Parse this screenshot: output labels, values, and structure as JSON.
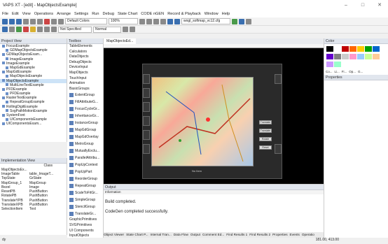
{
  "window": {
    "title": "VAPS XT - [edit] - MapObjectsExample]",
    "controls": [
      "–",
      "□",
      "✕"
    ]
  },
  "menu": [
    "File",
    "Edit",
    "View",
    "Operations",
    "Arrange",
    "Settings",
    "Run",
    "Debug",
    "State Chart",
    "CODE nGEN",
    "Record & Playback",
    "Window",
    "Help"
  ],
  "toolbar1": {
    "color_combo": "Default Colors",
    "zoom_combo": "100%",
    "file_combo": "wogl_softmap_vc12.cfg"
  },
  "toolbar2": {
    "line_combo": "Not Specified",
    "style_combo": "Normal"
  },
  "project_view": {
    "title": "Project View",
    "items": [
      {
        "label": "FocusExample",
        "sel": false
      },
      {
        "label": "GDMapObjectsExample",
        "sel": false
      },
      {
        "label": "GDMapObjectsExam...",
        "sel": false
      },
      {
        "label": "ImageExample",
        "sel": false
      },
      {
        "label": "ImageExample",
        "sel": false
      },
      {
        "label": "MapGdExample",
        "sel": false
      },
      {
        "label": "MapGdExample",
        "sel": false
      },
      {
        "label": "MapObjectsExample",
        "sel": false
      },
      {
        "label": "MapObjectsExample",
        "sel": true
      },
      {
        "label": "MultiLineTextExample",
        "sel": false
      },
      {
        "label": "PFDExample",
        "sel": false
      },
      {
        "label": "PFDExample",
        "sel": false
      },
      {
        "label": "RasterTextExample",
        "sel": false
      },
      {
        "label": "RepeatGroupExample",
        "sel": false
      },
      {
        "label": "RollingDigitExample",
        "sel": false
      },
      {
        "label": "SvgPathMotionExample",
        "sel": false
      },
      {
        "label": "SystemFont",
        "sel": false
      },
      {
        "label": "UIComponentsExample",
        "sel": false
      },
      {
        "label": "UIComponentsExam...",
        "sel": false
      }
    ]
  },
  "impl_view": {
    "title": "Implementation View",
    "class_header": "Class",
    "root": "MapObjectsEx...",
    "rows": [
      [
        "ImageTable",
        "table_ImageT..."
      ],
      [
        "TopState",
        "GrState"
      ],
      [
        "MapGroup_1",
        "MapGroup"
      ],
      [
        "Bezel",
        "Image"
      ],
      [
        "ResetPB",
        "PushButton"
      ],
      [
        "RotatePB",
        "PushButton"
      ],
      [
        "TranslateYPB",
        "PushButton"
      ],
      [
        "TranslateXPB",
        "PushButton"
      ],
      [
        "SelectionItem",
        "Text"
      ]
    ]
  },
  "toolbox": {
    "title": "Toolbox",
    "items": [
      "TableElements",
      "Calculators",
      "DataObjects",
      "DebugObjects",
      "DeviceInput",
      "MapObjects",
      "TouchInput",
      "Animation",
      "BasicGroups"
    ],
    "icons": [
      "ExtentGroup",
      "FillAttributeG...",
      "FocusCycleGr...",
      "InheritanceGr...",
      "InstanceGroup",
      "MapGdGroup",
      "MapGdOverlay",
      "MetroGroup",
      "MutuallyExclu...",
      "ParallelAttribu...",
      "PopUpContext",
      "PopUpPart",
      "ReorderGroup",
      "RepeatGroup",
      "ScaleToFitGr...",
      "SimpleGroup",
      "StencilGroup",
      "TranslateGr..."
    ],
    "bottom": [
      "GraphicPrimitives",
      "SVGPrimitives",
      "UI Components",
      "InputObjects",
      "OutputObjects"
    ]
  },
  "editor": {
    "tab": "MapObjectsEd...",
    "map_buttons": [
      "Translate",
      "Translate",
      "Rotate",
      "Reset"
    ],
    "selection_label": "No Item"
  },
  "output": {
    "title": "Output",
    "header": "Information",
    "lines": [
      "Build completed.",
      "CodeGen completed successfully."
    ],
    "tabs": [
      "Object Viewer",
      "State Chart P...",
      "Internal Tran...",
      "Data Flow",
      "Output",
      "Comment Ed...",
      "Find Results 1",
      "Find Results 2",
      "Properties",
      "Events",
      "Operatio"
    ]
  },
  "color_panel": {
    "title": "Color",
    "labels": [
      "Co...",
      "Li...",
      "Fi...",
      "Op...",
      "G..."
    ],
    "swatches": [
      "#000000",
      "#ffffff",
      "#c00000",
      "#ff6600",
      "#ffcc00",
      "#00a000",
      "#0066cc",
      "#6600cc",
      "#808080",
      "#cccccc",
      "#ff99cc",
      "#99ccff",
      "#ccff99",
      "#ffcc99",
      "#cc99ff",
      "#99ffcc"
    ]
  },
  "properties": {
    "title": "Properties"
  },
  "status": {
    "left": "dy",
    "right": "181.00, 413.00"
  }
}
